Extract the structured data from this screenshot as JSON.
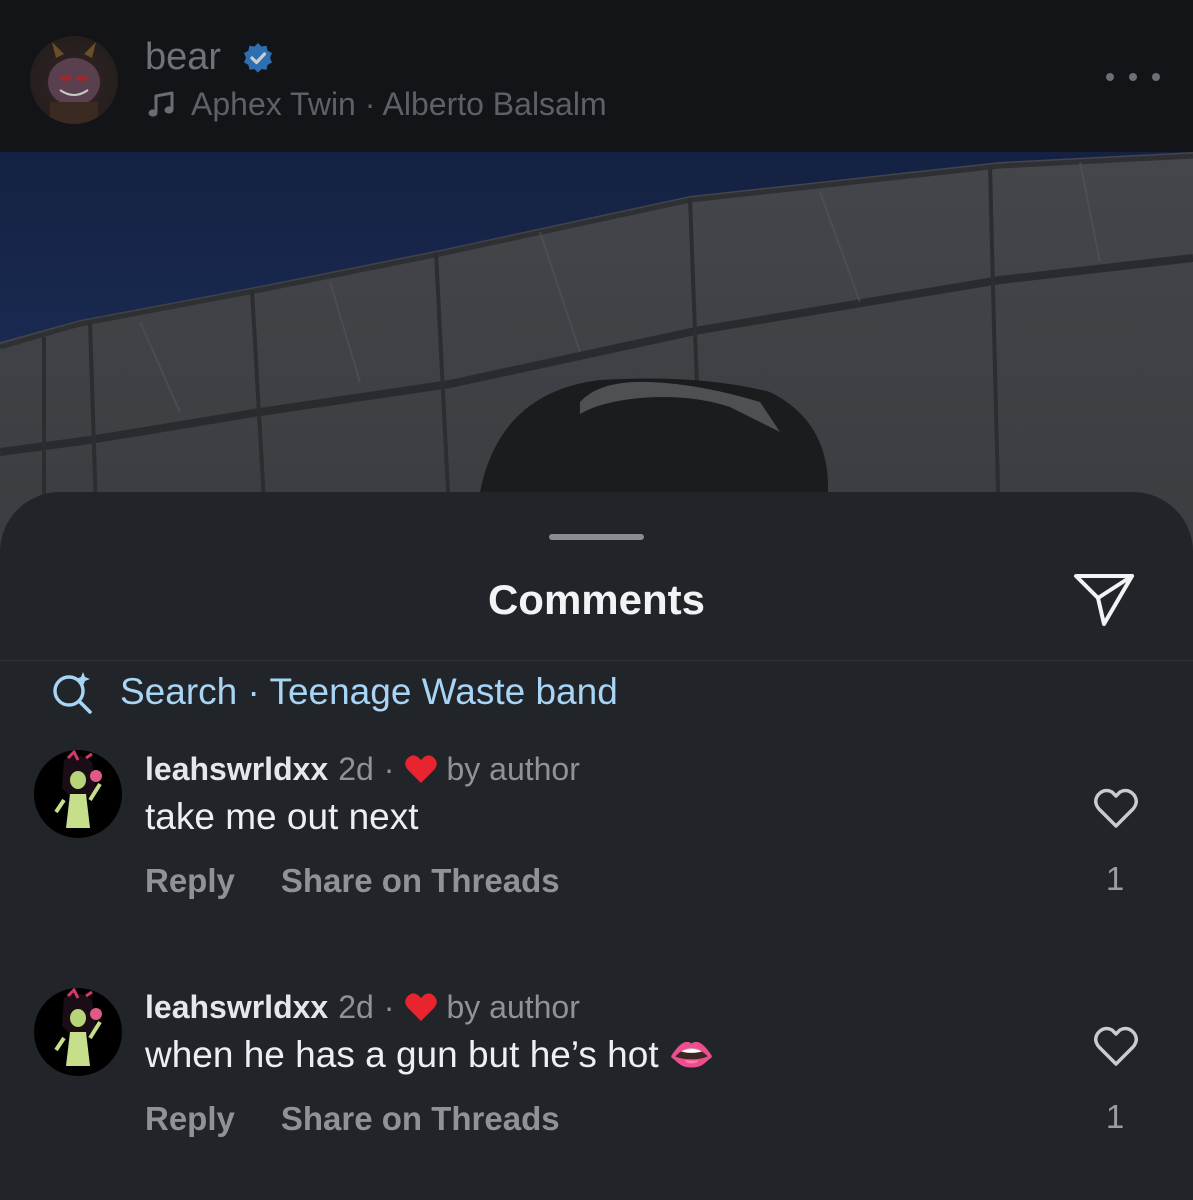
{
  "header": {
    "username": "bear",
    "verified_icon": "verified-badge-icon",
    "music_icon": "music-note-icon",
    "song": "Aphex Twin · Alberto Balsalm",
    "more_icon": "more-options-icon"
  },
  "sheet": {
    "title": "Comments",
    "share_icon": "paper-plane-icon",
    "search_icon": "search-sparkle-icon",
    "search_text": "Search · Teenage Waste band"
  },
  "comments": [
    {
      "username": "leahswrldxx",
      "time": "2d",
      "separator": "·",
      "liked_by_author": "by author",
      "text": "take me out next",
      "reply_label": "Reply",
      "share_label": "Share on Threads",
      "likes": "1"
    },
    {
      "username": "leahswrldxx",
      "time": "2d",
      "separator": "·",
      "liked_by_author": "by author",
      "text": "when he has a gun but he’s hot 👄",
      "reply_label": "Reply",
      "share_label": "Share on Threads",
      "likes": "1"
    }
  ],
  "colors": {
    "accent_search": "#a8d4f5",
    "verified_blue": "#2d6fb0",
    "heart_red": "#e8242f",
    "sheet_bg": "#212429"
  }
}
